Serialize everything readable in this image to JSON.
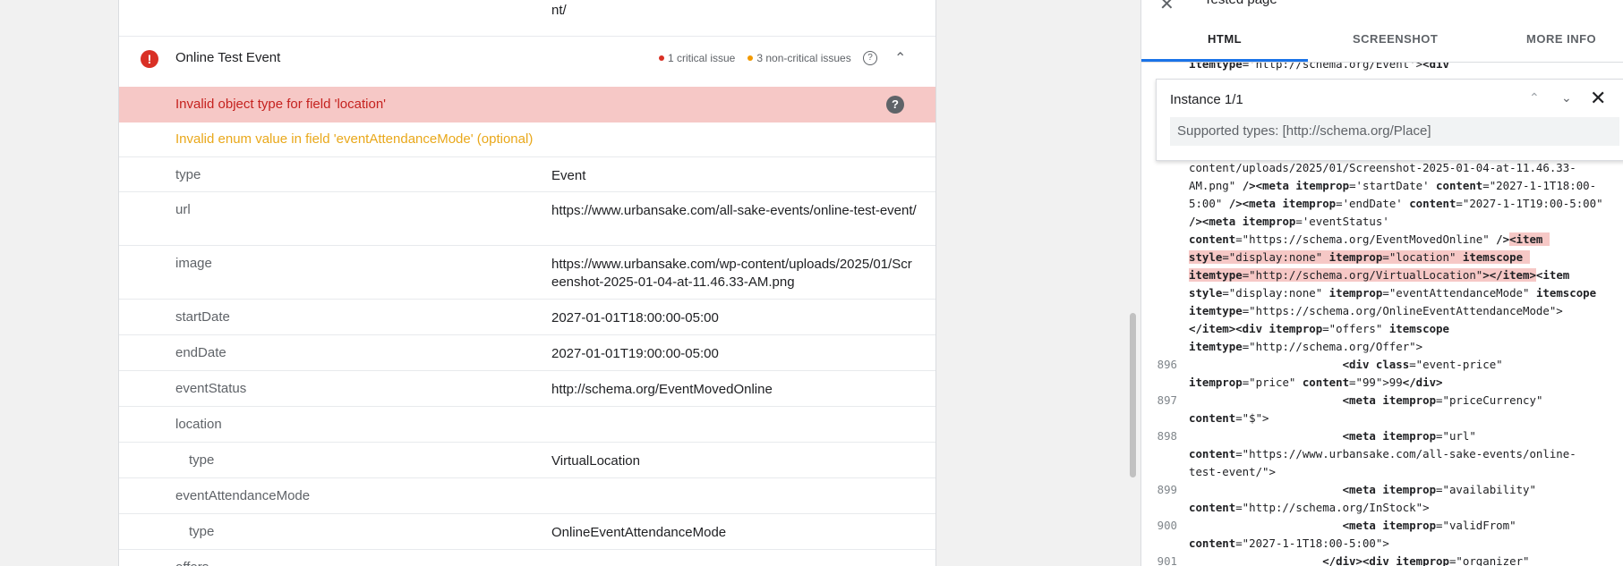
{
  "left": {
    "top_url_tail": "nt/",
    "event": {
      "title": "Online Test Event",
      "critical": "1 critical issue",
      "noncritical": "3 non-critical issues",
      "critical_color": "#d93025",
      "noncritical_color": "#f29900"
    },
    "error_row": "Invalid object type for field 'location'",
    "warning_row": "Invalid enum value in field 'eventAttendanceMode' (optional)",
    "props": [
      {
        "key": "type",
        "value": "Event"
      },
      {
        "key": "url",
        "value": "https://www.urbansake.com/all-sake-events/online-test-event/"
      },
      {
        "key": "image",
        "value": "https://www.urbansake.com/wp-content/uploads/2025/01/Screenshot-2025-01-04-at-11.46.33-AM.png"
      },
      {
        "key": "startDate",
        "value": "2027-01-01T18:00:00-05:00"
      },
      {
        "key": "endDate",
        "value": "2027-01-01T19:00:00-05:00"
      },
      {
        "key": "eventStatus",
        "value": "http://schema.org/EventMovedOnline"
      },
      {
        "key": "location",
        "value": ""
      },
      {
        "key": "type",
        "value": "VirtualLocation"
      },
      {
        "key": "eventAttendanceMode",
        "value": ""
      },
      {
        "key": "type",
        "value": "OnlineEventAttendanceMode"
      },
      {
        "key": "offers",
        "value": ""
      }
    ]
  },
  "right": {
    "panel_title": "Tested page",
    "tabs": [
      "HTML",
      "SCREENSHOT",
      "MORE INFO"
    ],
    "instance": {
      "label": "Instance 1/1",
      "supported": "Supported types: [http://schema.org/Place]"
    },
    "line_numbers": [
      "896",
      "897",
      "898",
      "899",
      "900",
      "901"
    ]
  }
}
